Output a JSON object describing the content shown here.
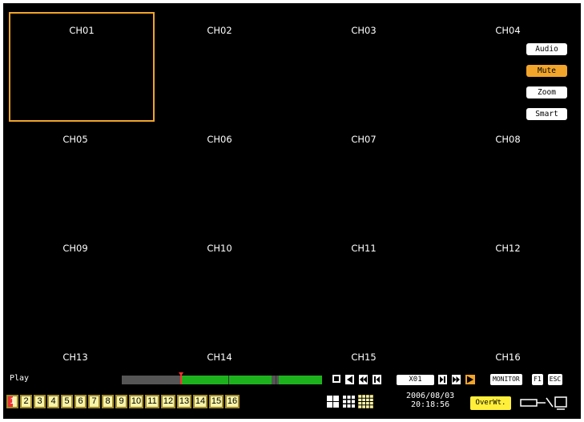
{
  "channels": [
    "CH01",
    "CH02",
    "CH03",
    "CH04",
    "CH05",
    "CH06",
    "CH07",
    "CH08",
    "CH09",
    "CH10",
    "CH11",
    "CH12",
    "CH13",
    "CH14",
    "CH15",
    "CH16"
  ],
  "side_buttons": {
    "audio": "Audio",
    "mute": "Mute",
    "zoom": "Zoom",
    "smart": "Smart"
  },
  "playback": {
    "mode_label": "Play",
    "speed": "X01",
    "monitor": "MONITOR",
    "f1": "F1",
    "esc": "ESC"
  },
  "channel_buttons": [
    "1",
    "2",
    "3",
    "4",
    "5",
    "6",
    "7",
    "8",
    "9",
    "10",
    "11",
    "12",
    "13",
    "14",
    "15",
    "16"
  ],
  "status": {
    "date": "2006/08/03",
    "time": "20:18:56",
    "overwrite": "OverWt."
  },
  "colors": {
    "selection": "#f2a52a",
    "timeline": "#1db21d",
    "overwrite_bg": "#ffef3a",
    "channel_button_bg": "#f7f3a8"
  }
}
